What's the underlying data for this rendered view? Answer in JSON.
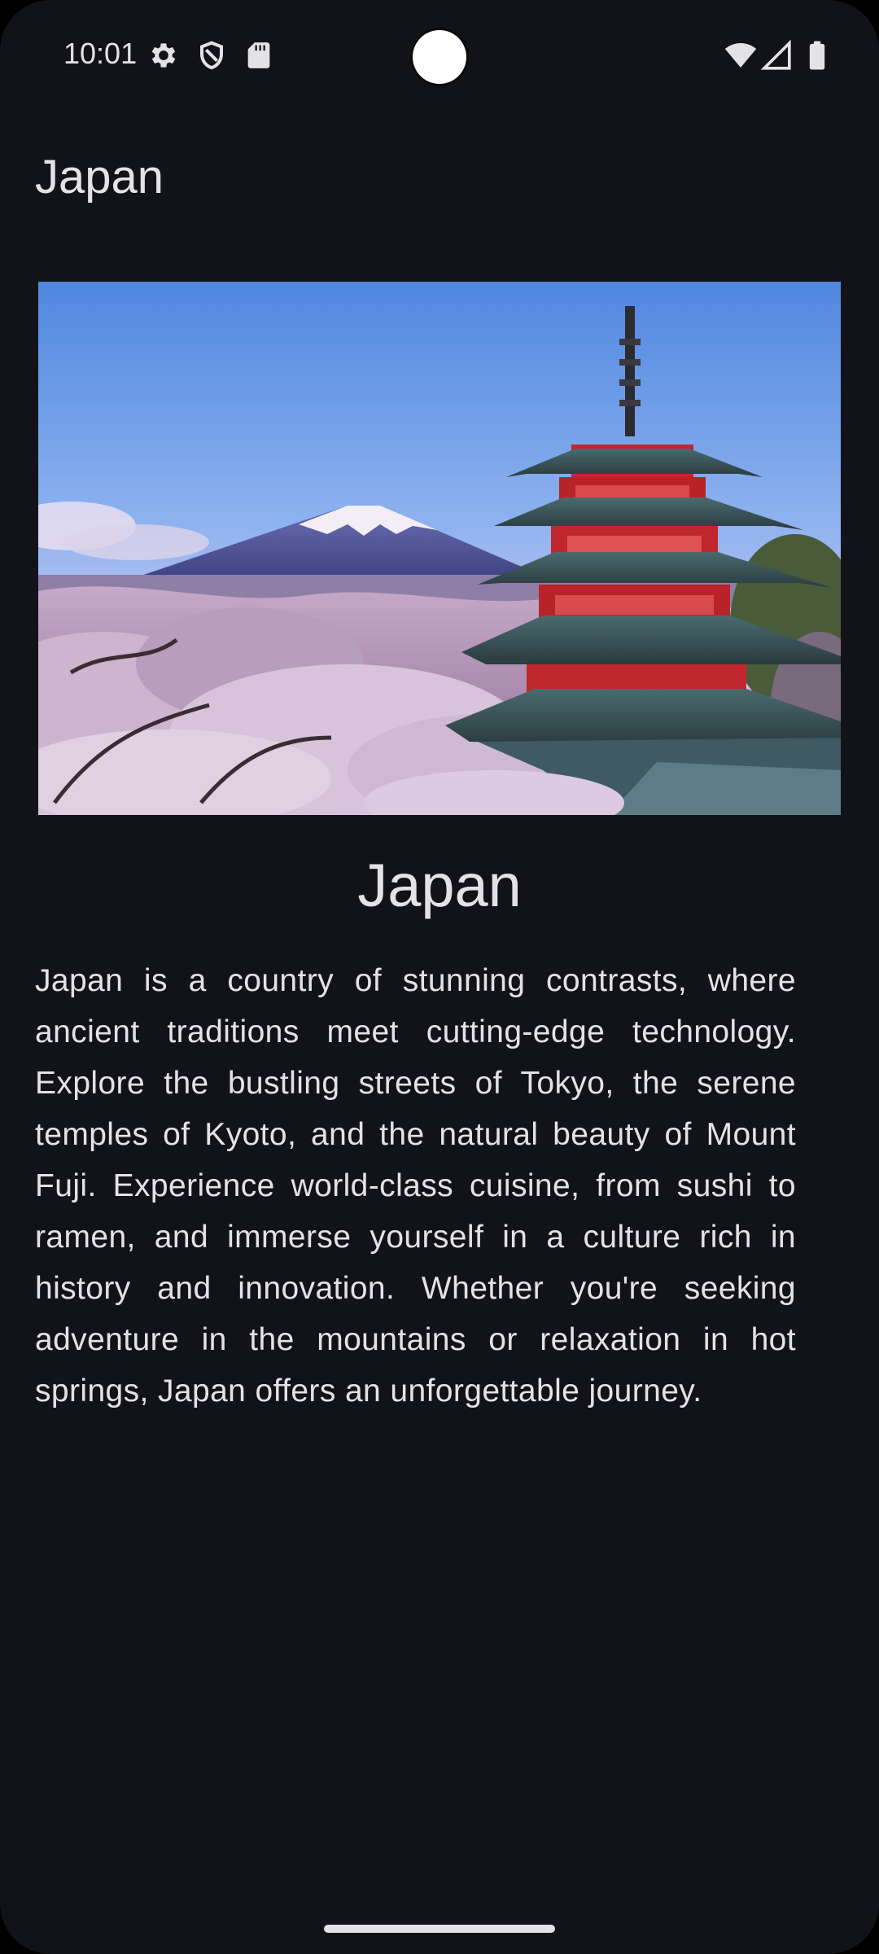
{
  "status_bar": {
    "time": "10:01",
    "left_icons": [
      "settings-gear-icon",
      "shield-icon",
      "sd-card-icon"
    ],
    "right_icons": [
      "wifi-icon",
      "cellular-signal-icon",
      "battery-icon"
    ]
  },
  "app_bar": {
    "title": "Japan"
  },
  "hero_image": {
    "subject": "pagoda-mount-fuji-cherry-blossoms-image"
  },
  "content": {
    "headline": "Japan",
    "description": "Japan is a country of stunning contrasts, where ancient traditions meet cutting-edge technology. Explore the bustling streets of Tokyo, the serene temples of Kyoto, and the natural beauty of Mount Fuji. Experience world-class cuisine, from sushi to ramen, and immerse yourself in a culture rich in history and innovation. Whether you're seeking adventure in the mountains or relaxation in hot springs, Japan offers an unforgettable journey."
  },
  "colors": {
    "background": "#111318",
    "on_surface": "#e3e2e6",
    "sky_top": "#5c8de0",
    "pagoda_red": "#c0262d"
  }
}
